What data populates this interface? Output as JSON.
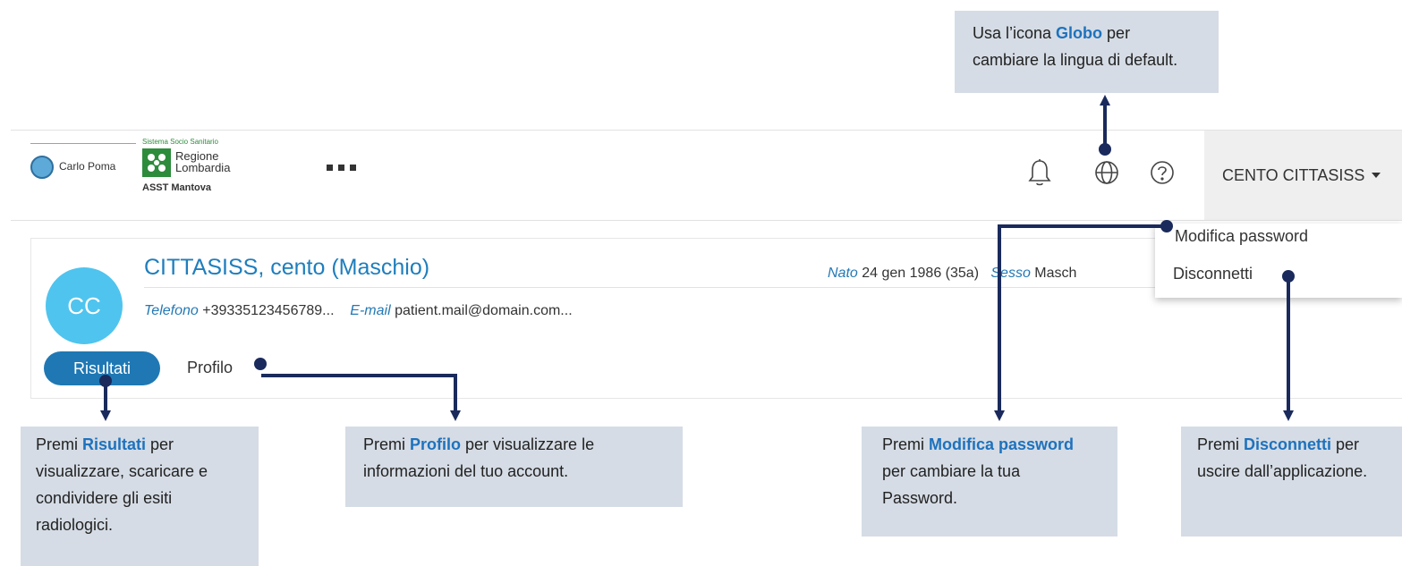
{
  "header": {
    "brand_left": "Carlo Poma",
    "brand_tagline": "Sistema Socio Sanitario",
    "brand_region_line1": "Regione",
    "brand_region_line2": "Lombardia",
    "brand_asst": "ASST Mantova",
    "notification_icon": "bell-icon",
    "language_icon": "globe-icon",
    "help_icon": "help-icon",
    "user_menu_label": "CENTO CITTASISS"
  },
  "patient": {
    "initials": "CC",
    "name": "CITTASISS, cento  (Maschio)",
    "born_label": "Nato",
    "born_value": "24 gen 1986 (35a)",
    "sex_label": "Sesso",
    "sex_value": "Masch",
    "phone_label": "Telefono",
    "phone_value": "+39335123456789...",
    "email_label": "E-mail",
    "email_value": "patient.mail@domain.com..."
  },
  "tabs": [
    {
      "label": "Risultati",
      "active": true
    },
    {
      "label": "Profilo",
      "active": false
    }
  ],
  "user_menu": {
    "items": [
      "Modifica password",
      "Disconnetti"
    ]
  },
  "callouts": {
    "globe": {
      "pre": "Usa l’icona ",
      "bold": "Globo",
      "post": " per cambiare la lingua di default."
    },
    "risultati": {
      "pre": "Premi ",
      "bold": "Risultati",
      "post": " per visualizzare, scaricare e condividere gli esiti radiologici."
    },
    "profilo": {
      "pre": "Premi ",
      "bold": "Profilo",
      "post": " per visualizzare le informazioni del tuo account."
    },
    "password": {
      "pre": "Premi ",
      "bold": "Modifica password",
      "post": " per cambiare la tua Password."
    },
    "logout": {
      "pre": "Premi ",
      "bold": "Disconnetti",
      "post": " per uscire dall’applicazione."
    }
  },
  "colors": {
    "accent": "#1f78b4",
    "avatar": "#4fc4ee",
    "callout_bg": "#d5dce5",
    "connector": "#1a2a5c"
  }
}
